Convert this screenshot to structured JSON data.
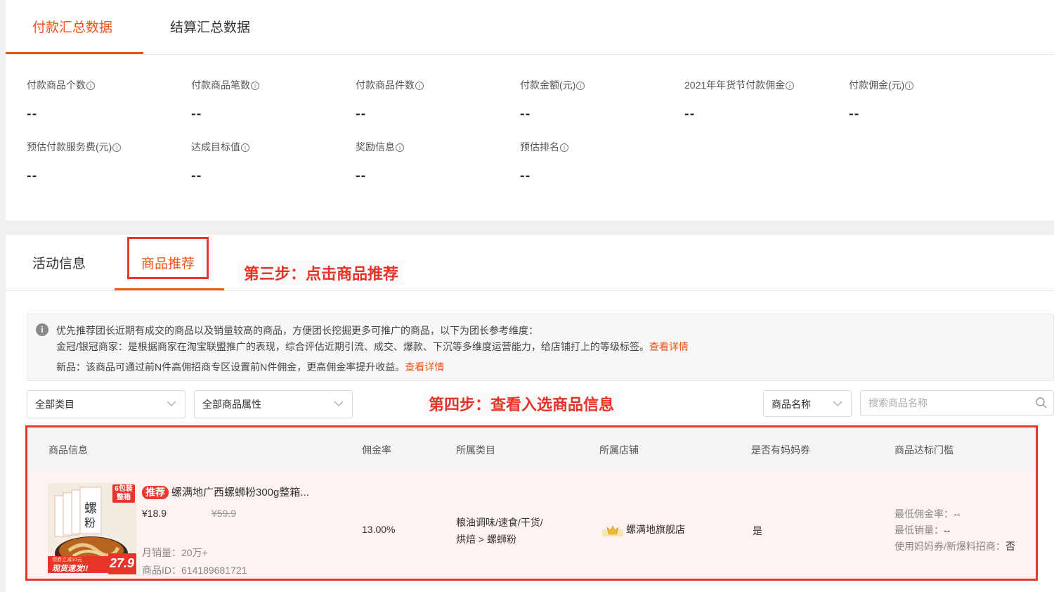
{
  "top_tabs": [
    "付款汇总数据",
    "结算汇总数据"
  ],
  "metrics": [
    {
      "label": "付款商品个数",
      "value": "--"
    },
    {
      "label": "付款商品笔数",
      "value": "--"
    },
    {
      "label": "付款商品件数",
      "value": "--"
    },
    {
      "label": "付款金额(元)",
      "value": "--"
    },
    {
      "label": "2021年年货节付款佣金",
      "value": "--"
    },
    {
      "label": "付款佣金(元)",
      "value": "--"
    },
    {
      "label": "预估付款服务费(元)",
      "value": "--"
    },
    {
      "label": "达成目标值",
      "value": "--"
    },
    {
      "label": "奖励信息",
      "value": "--"
    },
    {
      "label": "预估排名",
      "value": "--"
    }
  ],
  "info_icon_glyph": "i",
  "second_tabs": [
    "活动信息",
    "商品推荐"
  ],
  "step3_note": "第三步：点击商品推荐",
  "step4_note": "第四步：查看入选商品信息",
  "notice": {
    "line1": "优先推荐团长近期有成交的商品以及销量较高的商品，方便团长挖掘更多可推广的商品，以下为团长参考维度：",
    "line2": "金冠/银冠商家：是根据商家在淘宝联盟推广的表现，综合评估近期引流、成交、爆款、下沉等多维度运营能力，给店铺打上的等级标签。",
    "line2_link": "查看详情",
    "line3": "新品：该商品可通过前N件高佣招商专区设置前N件佣金，更高佣金率提升收益。",
    "line3_link": "查看详情"
  },
  "filters": {
    "category": "全部类目",
    "attribute": "全部商品属性",
    "search_field": "商品名称",
    "search_placeholder": "搜索商品名称"
  },
  "table": {
    "headers": [
      "商品信息",
      "佣金率",
      "所属类目",
      "所属店铺",
      "是否有妈妈券",
      "商品达标门槛"
    ],
    "row": {
      "tag": "推荐",
      "title": "螺满地广西螺蛳粉300g整箱...",
      "price": "¥18.9",
      "orig_price": "¥59.9",
      "monthly_sales": "月销量：20万+",
      "product_id": "商品ID：614189681721",
      "commission": "13.00%",
      "category_line1": "粮油调味/速食/干货/",
      "category_line2": "烘焙 > 螺蛳粉",
      "shop": "螺满地旗舰店",
      "has_coupon": "是",
      "threshold_rate_label": "最低佣金率：",
      "threshold_rate": "--",
      "threshold_sales_label": "最低销量：",
      "threshold_sales": "--",
      "threshold_coupon_label": "使用妈妈券/新爆料招商：",
      "threshold_coupon": "否",
      "thumb_badge": "6包装整箱",
      "thumb_banner": "现货速发!!",
      "thumb_price": "27.9",
      "thumb_promo": "领券立减10元"
    }
  },
  "colors": {
    "accent": "#f0531c",
    "annotation_red": "#e53a2a"
  }
}
